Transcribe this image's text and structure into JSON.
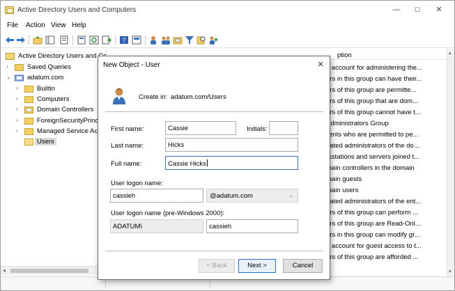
{
  "window": {
    "title": "Active Directory Users and Computers",
    "controls": {
      "minimize": "—",
      "maximize": "☐",
      "close": "✕"
    }
  },
  "menu": [
    "File",
    "Action",
    "View",
    "Help"
  ],
  "toolbar_icons": [
    "back-arrow-icon",
    "forward-arrow-icon",
    "up-folder-icon",
    "show-tree-icon",
    "properties-icon",
    "export-list-icon",
    "refresh-icon",
    "export-icon",
    "help-icon",
    "mmc-console-icon",
    "new-user-icon",
    "new-group-icon",
    "new-ou-icon",
    "filter-icon",
    "find-icon",
    "add-to-group-icon"
  ],
  "tree": [
    {
      "label": "Active Directory Users and Com",
      "chevron": "",
      "level": 0,
      "icon": "aduc-root-icon"
    },
    {
      "label": "Saved Queries",
      "chevron": "›",
      "level": 1,
      "icon": "folder-icon"
    },
    {
      "label": "adatum.com",
      "chevron": "⌄",
      "level": 1,
      "icon": "domain-icon"
    },
    {
      "label": "Builtin",
      "chevron": "›",
      "level": 2,
      "icon": "folder-icon"
    },
    {
      "label": "Computers",
      "chevron": "›",
      "level": 2,
      "icon": "folder-icon"
    },
    {
      "label": "Domain Controllers",
      "chevron": "›",
      "level": 2,
      "icon": "ou-icon"
    },
    {
      "label": "ForeignSecurityPrincipa",
      "chevron": "›",
      "level": 2,
      "icon": "folder-icon"
    },
    {
      "label": "Managed Service Accou",
      "chevron": "›",
      "level": 2,
      "icon": "folder-icon"
    },
    {
      "label": "Users",
      "chevron": "",
      "level": 2,
      "icon": "folder-icon",
      "selected": true
    }
  ],
  "details": {
    "column_header": "ption",
    "descriptions": [
      "n account for administering the...",
      "ers in this group can have their...",
      "ers of this group are permitte...",
      "ers of this group that are dom...",
      "ers of this group cannot have t...",
      "Administrators Group",
      "lients who are permitted to pe...",
      "nated administrators of the do...",
      "rkstations and servers joined t...",
      "main controllers in the domain",
      "main guests",
      "main users",
      "nated administrators of the ent...",
      "ers of this group can perform ...",
      "ers of this group are Read-Onl...",
      "ers in this group can modify gr...",
      "n account for guest access to t...",
      "ers of this group are afforded ..."
    ]
  },
  "dialog": {
    "title": "New Object - User",
    "close": "✕",
    "create_in_label": "Create in:",
    "create_in_value": "adatum.com/Users",
    "first_name_label": "First name:",
    "first_name_value": "Cassie",
    "initials_label": "Initials:",
    "initials_value": "",
    "last_name_label": "Last name:",
    "last_name_value": "Hicks",
    "full_name_label": "Full name:",
    "full_name_value": "Cassie Hicks",
    "logon_label": "User logon name:",
    "logon_value": "cassieh",
    "domain_suffix": "@adatum.com",
    "pre2000_label": "User logon name (pre-Windows 2000):",
    "pre2000_domain": "ADATUM\\",
    "pre2000_value": "cassieh",
    "back_button": "< Back",
    "next_button": "Next >",
    "cancel_button": "Cancel"
  }
}
